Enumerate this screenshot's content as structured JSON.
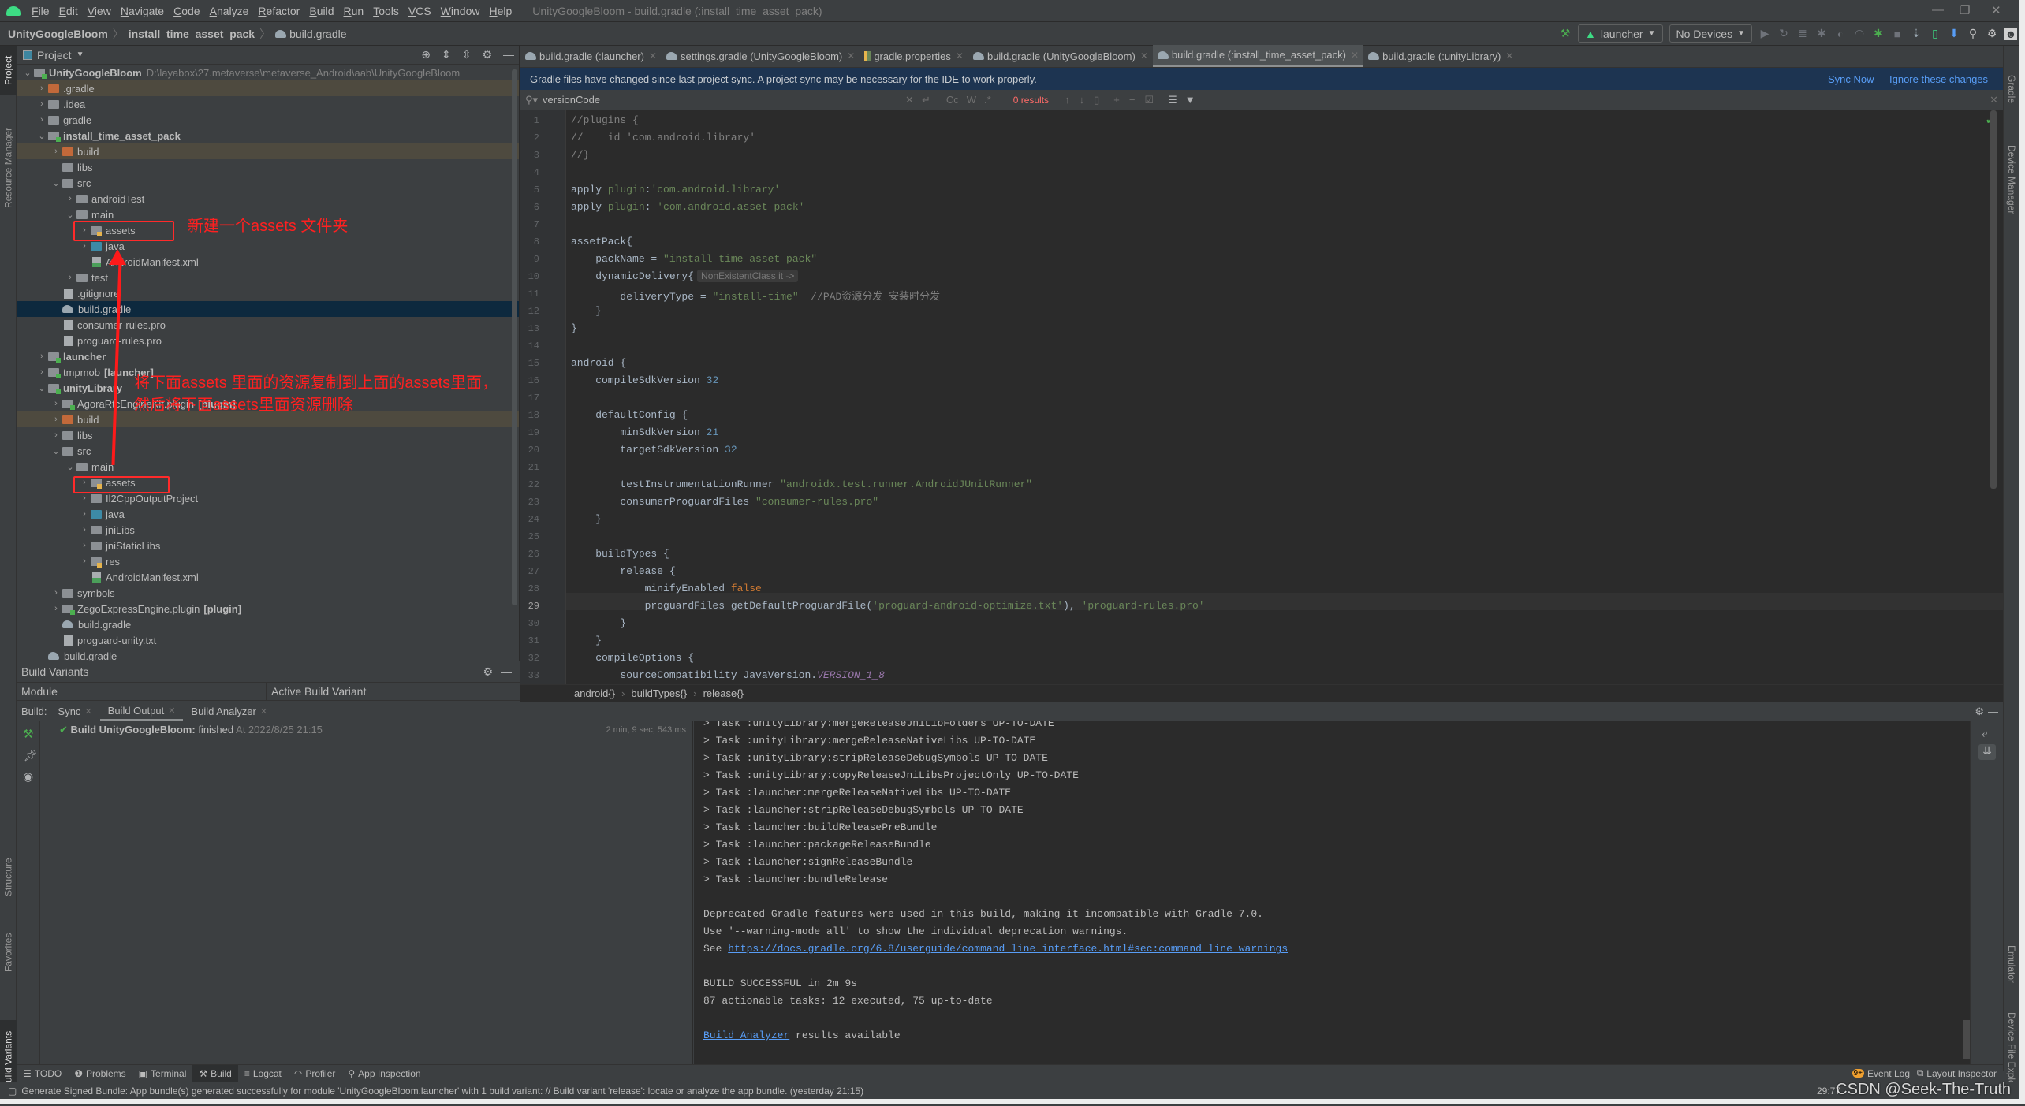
{
  "app": {
    "menu": [
      "File",
      "Edit",
      "View",
      "Navigate",
      "Code",
      "Analyze",
      "Refactor",
      "Build",
      "Run",
      "Tools",
      "VCS",
      "Window",
      "Help"
    ],
    "window_title": "UnityGoogleBloom - build.gradle (:install_time_asset_pack)"
  },
  "navbar": {
    "crumbs": [
      "UnityGoogleBloom",
      "install_time_asset_pack",
      "build.gradle"
    ],
    "run_config": "launcher",
    "device": "No Devices"
  },
  "left_stripe": {
    "tabs": [
      "Project",
      "Resource Manager",
      "Structure",
      "Favorites",
      "Build Variants"
    ]
  },
  "right_stripe": {
    "tabs": [
      "Gradle",
      "Device Manager",
      "Emulator",
      "Device File Explorer"
    ]
  },
  "project_panel": {
    "title": "Project",
    "tree": [
      {
        "label": "UnityGoogleBloom",
        "extra": "D:\\layabox\\27.metaverse\\metaverse_Android\\aab\\UnityGoogleBloom",
        "depth": 0,
        "arrow": "v",
        "icon": "module",
        "bold": true
      },
      {
        "label": ".gradle",
        "depth": 1,
        "arrow": ">",
        "icon": "orange",
        "excluded": true
      },
      {
        "label": ".idea",
        "depth": 1,
        "arrow": ">",
        "icon": "folder"
      },
      {
        "label": "gradle",
        "depth": 1,
        "arrow": ">",
        "icon": "folder"
      },
      {
        "label": "install_time_asset_pack",
        "depth": 1,
        "arrow": "v",
        "icon": "module",
        "bold": true
      },
      {
        "label": "build",
        "depth": 2,
        "arrow": ">",
        "icon": "orange",
        "excluded": true
      },
      {
        "label": "libs",
        "depth": 2,
        "arrow": "",
        "icon": "folder"
      },
      {
        "label": "src",
        "depth": 2,
        "arrow": "v",
        "icon": "folder"
      },
      {
        "label": "androidTest",
        "depth": 3,
        "arrow": ">",
        "icon": "folder"
      },
      {
        "label": "main",
        "depth": 3,
        "arrow": "v",
        "icon": "folder"
      },
      {
        "label": "assets",
        "depth": 4,
        "arrow": ">",
        "icon": "res"
      },
      {
        "label": "java",
        "depth": 4,
        "arrow": ">",
        "icon": "blue"
      },
      {
        "label": "AndroidManifest.xml",
        "depth": 4,
        "arrow": "",
        "icon": "mf"
      },
      {
        "label": "test",
        "depth": 3,
        "arrow": ">",
        "icon": "folder"
      },
      {
        "label": ".gitignore",
        "depth": 2,
        "arrow": "",
        "icon": "file"
      },
      {
        "label": "build.gradle",
        "depth": 2,
        "arrow": "",
        "icon": "gradle",
        "selected": true
      },
      {
        "label": "consumer-rules.pro",
        "depth": 2,
        "arrow": "",
        "icon": "file"
      },
      {
        "label": "proguard-rules.pro",
        "depth": 2,
        "arrow": "",
        "icon": "file"
      },
      {
        "label": "launcher",
        "depth": 1,
        "arrow": ">",
        "icon": "module",
        "bold": true
      },
      {
        "label": "tmpmob",
        "extra_bold": "[launcher]",
        "depth": 1,
        "arrow": ">",
        "icon": "module"
      },
      {
        "label": "unityLibrary",
        "depth": 1,
        "arrow": "v",
        "icon": "module",
        "bold": true
      },
      {
        "label": "AgoraRtcEngineKit.plugin",
        "extra_bold": "[plugin]",
        "depth": 2,
        "arrow": ">",
        "icon": "module"
      },
      {
        "label": "build",
        "depth": 2,
        "arrow": ">",
        "icon": "orange",
        "excluded": true
      },
      {
        "label": "libs",
        "depth": 2,
        "arrow": ">",
        "icon": "folder"
      },
      {
        "label": "src",
        "depth": 2,
        "arrow": "v",
        "icon": "folder"
      },
      {
        "label": "main",
        "depth": 3,
        "arrow": "v",
        "icon": "folder"
      },
      {
        "label": "assets",
        "depth": 4,
        "arrow": ">",
        "icon": "res"
      },
      {
        "label": "Il2CppOutputProject",
        "depth": 4,
        "arrow": ">",
        "icon": "folder"
      },
      {
        "label": "java",
        "depth": 4,
        "arrow": ">",
        "icon": "blue"
      },
      {
        "label": "jniLibs",
        "depth": 4,
        "arrow": ">",
        "icon": "folder"
      },
      {
        "label": "jniStaticLibs",
        "depth": 4,
        "arrow": ">",
        "icon": "folder"
      },
      {
        "label": "res",
        "depth": 4,
        "arrow": ">",
        "icon": "res"
      },
      {
        "label": "AndroidManifest.xml",
        "depth": 4,
        "arrow": "",
        "icon": "mf"
      },
      {
        "label": "symbols",
        "depth": 2,
        "arrow": ">",
        "icon": "folder"
      },
      {
        "label": "ZegoExpressEngine.plugin",
        "extra_bold": "[plugin]",
        "depth": 2,
        "arrow": ">",
        "icon": "module"
      },
      {
        "label": "build.gradle",
        "depth": 2,
        "arrow": "",
        "icon": "gradle"
      },
      {
        "label": "proguard-unity.txt",
        "depth": 2,
        "arrow": "",
        "icon": "file"
      },
      {
        "label": "build.gradle",
        "depth": 1,
        "arrow": "",
        "icon": "gradle"
      }
    ]
  },
  "annotations": {
    "top_note": "新建一个assets 文件夹",
    "bottom_note_line1": "将下面assets 里面的资源复制到上面的assets里面，",
    "bottom_note_line2": "然后将下面assets里面资源删除"
  },
  "build_variants": {
    "title": "Build Variants",
    "col_module": "Module",
    "col_variant": "Active Build Variant"
  },
  "editor_tabs": [
    {
      "label": "build.gradle (:launcher)",
      "active": false
    },
    {
      "label": "settings.gradle (UnityGoogleBloom)",
      "active": false
    },
    {
      "label": "gradle.properties",
      "active": false
    },
    {
      "label": "build.gradle (UnityGoogleBloom)",
      "active": false
    },
    {
      "label": "build.gradle (:install_time_asset_pack)",
      "active": true
    },
    {
      "label": "build.gradle (:unityLibrary)",
      "active": false
    }
  ],
  "banner": {
    "message": "Gradle files have changed since last project sync. A project sync may be necessary for the IDE to work properly.",
    "sync_now": "Sync Now",
    "ignore": "Ignore these changes"
  },
  "search": {
    "query": "versionCode",
    "results": "0 results",
    "opt_cc": "Cc",
    "opt_w": "W",
    "opt_regex": ".*"
  },
  "editor": {
    "current_line": 29,
    "lines": [
      "//plugins {",
      "//    id 'com.android.library'",
      "//}",
      "",
      "apply plugin:'com.android.library'",
      "apply plugin: 'com.android.asset-pack'",
      "",
      "assetPack{",
      "    packName = \"install_time_asset_pack\"",
      "    dynamicDelivery{",
      "        deliveryType = \"install-time\"  //PAD资源分发 安装时分发",
      "    }",
      "}",
      "",
      "android {",
      "    compileSdkVersion 32",
      "",
      "    defaultConfig {",
      "        minSdkVersion 21",
      "        targetSdkVersion 32",
      "",
      "        testInstrumentationRunner \"androidx.test.runner.AndroidJUnitRunner\"",
      "        consumerProguardFiles \"consumer-rules.pro\"",
      "    }",
      "",
      "    buildTypes {",
      "        release {",
      "            minifyEnabled false",
      "            proguardFiles getDefaultProguardFile('proguard-android-optimize.txt'), 'proguard-rules.pro'",
      "        }",
      "    }",
      "    compileOptions {",
      "        sourceCompatibility JavaVersion.VERSION_1_8"
    ],
    "inlay_hint": "NonExistentClass it ->",
    "breadcrumbs": [
      "android{}",
      "buildTypes{}",
      "release{}"
    ]
  },
  "build": {
    "label": "Build:",
    "tabs": [
      {
        "label": "Sync"
      },
      {
        "label": "Build Output",
        "active": true
      },
      {
        "label": "Build Analyzer"
      }
    ],
    "tree_item": {
      "title": "Build UnityGoogleBloom:",
      "status": "finished",
      "time": "At 2022/8/25 21:15",
      "duration": "2 min, 9 sec, 543 ms"
    },
    "console": [
      "> Task :unityLibrary:mergeReleaseJniLibFolders UP-TO-DATE",
      "> Task :unityLibrary:mergeReleaseNativeLibs UP-TO-DATE",
      "> Task :unityLibrary:stripReleaseDebugSymbols UP-TO-DATE",
      "> Task :unityLibrary:copyReleaseJniLibsProjectOnly UP-TO-DATE",
      "> Task :launcher:mergeReleaseNativeLibs UP-TO-DATE",
      "> Task :launcher:stripReleaseDebugSymbols UP-TO-DATE",
      "> Task :launcher:buildReleasePreBundle",
      "> Task :launcher:packageReleaseBundle",
      "> Task :launcher:signReleaseBundle",
      "> Task :launcher:bundleRelease",
      "",
      "Deprecated Gradle features were used in this build, making it incompatible with Gradle 7.0.",
      "Use '--warning-mode all' to show the individual deprecation warnings."
    ],
    "see_prefix": "See ",
    "see_link": "https://docs.gradle.org/6.8/userguide/command_line_interface.html#sec:command_line_warnings",
    "success": "BUILD SUCCESSFUL in 2m 9s",
    "tasks": "87 actionable tasks: 12 executed, 75 up-to-date",
    "analyzer_link": "Build Analyzer",
    "analyzer_suffix": " results available"
  },
  "tool_strip": {
    "items": [
      {
        "label": "TODO"
      },
      {
        "label": "Problems"
      },
      {
        "label": "Terminal"
      },
      {
        "label": "Build",
        "active": true
      },
      {
        "label": "Logcat"
      },
      {
        "label": "Profiler"
      },
      {
        "label": "App Inspection"
      }
    ],
    "event_log": "Event Log",
    "event_badge": "9+",
    "layout_inspector": "Layout Inspector"
  },
  "statusbar": {
    "message": "Generate Signed Bundle: App bundle(s) generated successfully for module 'UnityGoogleBloom.launcher' with 1 build variant: // Build variant 'release': locate or analyze the app bundle. (yesterday 21:15)",
    "position": "29:77",
    "watermark": "CSDN @Seek-The-Truth"
  }
}
